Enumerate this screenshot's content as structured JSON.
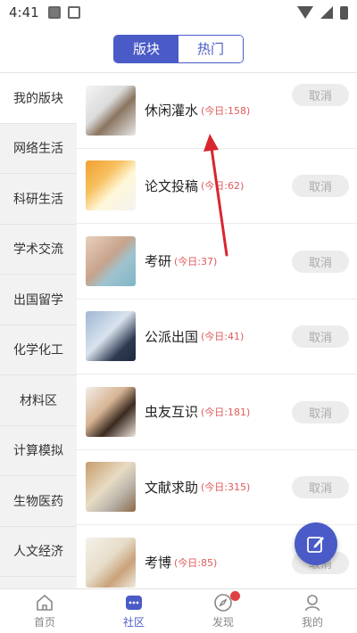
{
  "status_bar": {
    "time": "4:41"
  },
  "header": {
    "tabs": [
      {
        "label": "版块",
        "active": true
      },
      {
        "label": "热门",
        "active": false
      }
    ]
  },
  "sidebar": {
    "items": [
      {
        "label": "我的版块",
        "active": true
      },
      {
        "label": "网络生活"
      },
      {
        "label": "科研生活"
      },
      {
        "label": "学术交流"
      },
      {
        "label": "出国留学"
      },
      {
        "label": "化学化工"
      },
      {
        "label": "材料区"
      },
      {
        "label": "计算模拟"
      },
      {
        "label": "生物医药"
      },
      {
        "label": "人文经济"
      }
    ]
  },
  "forums": [
    {
      "name": "休闲灌水",
      "today": "(今日:158)",
      "action": "取消"
    },
    {
      "name": "论文投稿",
      "today": "(今日:62)",
      "action": "取消"
    },
    {
      "name": "考研",
      "today": "(今日:37)",
      "action": "取消"
    },
    {
      "name": "公派出国",
      "today": "(今日:41)",
      "action": "取消"
    },
    {
      "name": "虫友互识",
      "today": "(今日:181)",
      "action": "取消"
    },
    {
      "name": "文献求助",
      "today": "(今日:315)",
      "action": "取消"
    },
    {
      "name": "考博",
      "today": "(今日:85)",
      "action": "取消"
    }
  ],
  "tabbar": {
    "items": [
      {
        "label": "首页",
        "icon": "home-icon"
      },
      {
        "label": "社区",
        "icon": "community-icon",
        "active": true
      },
      {
        "label": "发现",
        "icon": "compass-icon",
        "badge": true
      },
      {
        "label": "我的",
        "icon": "profile-icon"
      }
    ]
  },
  "colors": {
    "accent": "#4a5bc7",
    "today_count": "#e05a5a",
    "badge": "#e04040",
    "arrow": "#d8262f"
  }
}
